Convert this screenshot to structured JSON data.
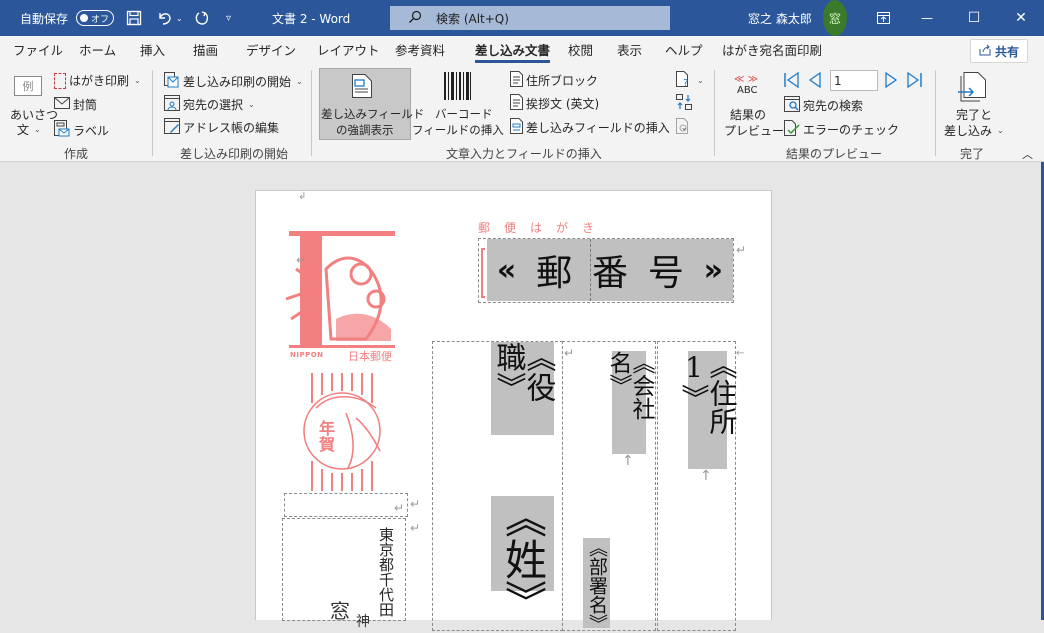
{
  "titlebar": {
    "autosave_label": "自動保存",
    "autosave_state": "オフ",
    "save_icon": "save-icon",
    "undo_icon": "undo-icon",
    "redo_icon": "redo-icon",
    "customize_icon": "customize-quick-access-icon",
    "document_title": "文書 2  -  Word",
    "search_placeholder": "検索 (Alt+Q)",
    "user_name": "窓之 森太郎",
    "avatar_text": "窓",
    "ribbon_display_icon": "ribbon-display-options-icon",
    "minimize_glyph": "—",
    "maximize_glyph": "☐",
    "close_glyph": "✕"
  },
  "tabs": [
    {
      "label": "ファイル",
      "active": false
    },
    {
      "label": "ホーム",
      "active": false
    },
    {
      "label": "挿入",
      "active": false
    },
    {
      "label": "描画",
      "active": false
    },
    {
      "label": "デザイン",
      "active": false
    },
    {
      "label": "レイアウト",
      "active": false
    },
    {
      "label": "参考資料",
      "active": false
    },
    {
      "label": "差し込み文書",
      "active": true
    },
    {
      "label": "校閲",
      "active": false
    },
    {
      "label": "表示",
      "active": false
    },
    {
      "label": "ヘルプ",
      "active": false
    },
    {
      "label": "はがき宛名面印刷",
      "active": false
    }
  ],
  "share_label": "共有",
  "ribbon": {
    "create": {
      "group_label": "作成",
      "greeting_icon_text": "例",
      "greeting_label_1": "あいさつ",
      "greeting_label_2": "文",
      "postcard_print": "はがき印刷",
      "envelope": "封筒",
      "label": "ラベル"
    },
    "start_merge": {
      "group_label": "差し込み印刷の開始",
      "start": "差し込み印刷の開始",
      "select_recipients": "宛先の選択",
      "edit_list": "アドレス帳の編集"
    },
    "write_insert": {
      "group_label": "文章入力とフィールドの挿入",
      "highlight_1": "差し込みフィールド",
      "highlight_2": "の強調表示",
      "barcode_1": "バーコード",
      "barcode_2": "フィールドの挿入",
      "address_block": "住所ブロック",
      "greeting_line": "挨拶文 (英文)",
      "insert_field": "差し込みフィールドの挿入"
    },
    "preview": {
      "group_label": "結果のプレビュー",
      "abc_arrows": "≪ ≫",
      "abc": "ABC",
      "preview_1": "結果の",
      "preview_2": "プレビュー",
      "record_number": "1",
      "find_recipient": "宛先の検索",
      "check_errors": "エラーのチェック"
    },
    "finish": {
      "group_label": "完了",
      "finish_1": "完了と",
      "finish_2": "差し込み"
    }
  },
  "document": {
    "postcard_header": "郵　便　は　が　き",
    "postal_code_field": "«郵 番 号»",
    "postal_code_chars": [
      "«",
      "郵",
      "番",
      "号",
      "»"
    ],
    "stamp_caption_en": "NIPPON",
    "stamp_caption_jp": "日本郵便",
    "nenga_text": "年賀",
    "fields": {
      "title": "《役職》",
      "company": "《会社名》",
      "address1": "《住所1》",
      "surname": "《姓》",
      "department": "《部署名》"
    },
    "sender_address": "東京都千代田",
    "sender_name_fragment": "窓",
    "sender_fragment_2": "神",
    "paragraph_mark": "↵"
  }
}
